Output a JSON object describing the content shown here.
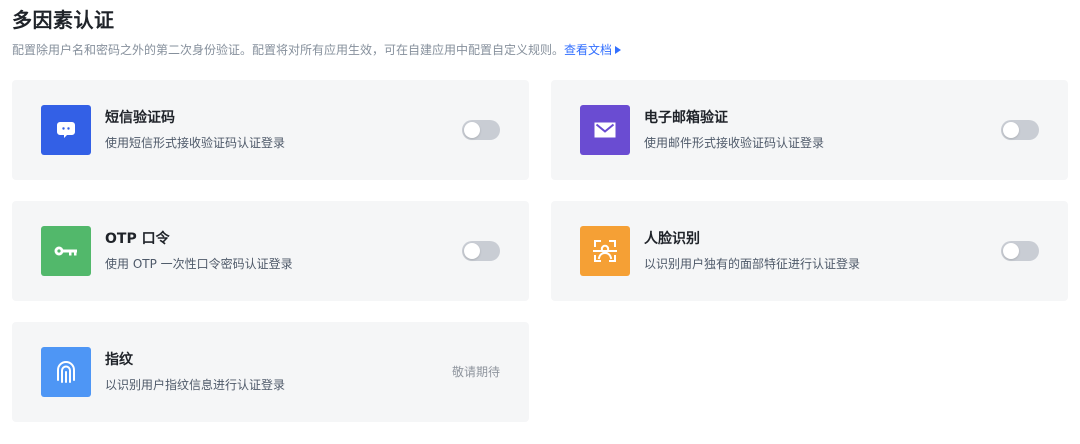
{
  "header": {
    "title": "多因素认证",
    "description": "配置除用户名和密码之外的第二次身份验证。配置将对所有应用生效，可在自建应用中配置自定义规则。",
    "doc_link_label": "查看文档"
  },
  "methods": [
    {
      "title": "短信验证码",
      "description": "使用短信形式接收验证码认证登录",
      "icon": "sms-message-icon",
      "icon_color": "#3360e6",
      "enabled": false
    },
    {
      "title": "电子邮箱验证",
      "description": "使用邮件形式接收验证码认证登录",
      "icon": "email-envelope-icon",
      "icon_color": "#6a4cd2",
      "enabled": false
    },
    {
      "title": "OTP 口令",
      "description": "使用 OTP 一次性口令密码认证登录",
      "icon": "key-icon",
      "icon_color": "#52b86b",
      "enabled": false
    },
    {
      "title": "人脸识别",
      "description": "以识别用户独有的面部特征进行认证登录",
      "icon": "face-scan-icon",
      "icon_color": "#f5a035",
      "enabled": false
    },
    {
      "title": "指纹",
      "description": "以识别用户指纹信息进行认证登录",
      "icon": "fingerprint-icon",
      "icon_color": "#4e96f5",
      "status_label": "敬请期待"
    }
  ],
  "colors": {
    "link": "#3370ff",
    "card_background": "#f5f6f7",
    "toggle_off": "#c9cdd4"
  }
}
